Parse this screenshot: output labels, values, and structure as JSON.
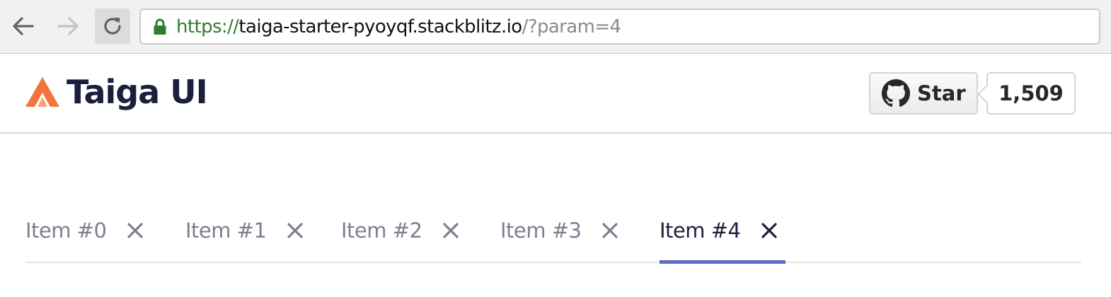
{
  "browser": {
    "url_scheme": "https://",
    "url_host": "taiga-starter-pyoyqf.stackblitz.io",
    "url_rest": "/?param=4",
    "icons": [
      "arrow-left-icon",
      "arrow-right-icon",
      "reload-icon",
      "lock-icon"
    ]
  },
  "header": {
    "logo_text": "Taiga UI",
    "logo_icon": "taiga-logo-icon",
    "logo_color": "#f1743d",
    "star_label": "Star",
    "star_count": "1,509",
    "github_icon": "github-icon"
  },
  "tabs": [
    {
      "label": "Item #0",
      "active": false
    },
    {
      "label": "Item #1",
      "active": false
    },
    {
      "label": "Item #2",
      "active": false
    },
    {
      "label": "Item #3",
      "active": false
    },
    {
      "label": "Item #4",
      "active": true
    }
  ],
  "colors": {
    "accent": "#5c6bc0",
    "secure": "#2e7d32",
    "text_dark": "#1b1f3b",
    "text_muted": "#7b7f8f"
  }
}
